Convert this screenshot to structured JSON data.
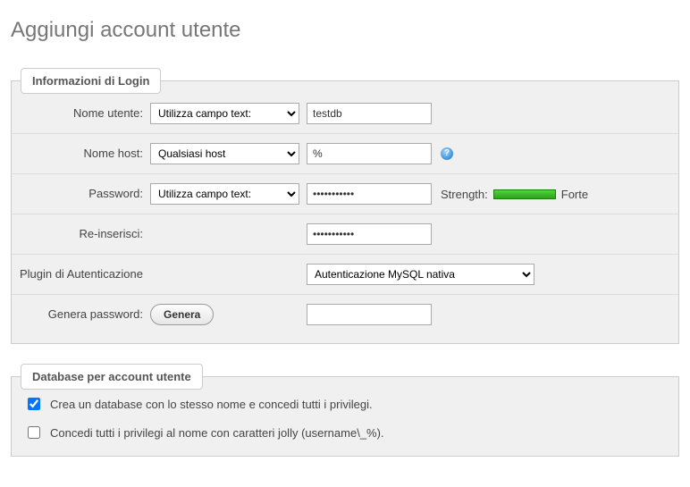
{
  "pageTitle": "Aggiungi account utente",
  "login": {
    "legend": "Informazioni di Login",
    "username": {
      "label": "Nome utente:",
      "selectValue": "Utilizza campo text:",
      "inputValue": "testdb"
    },
    "host": {
      "label": "Nome host:",
      "selectValue": "Qualsiasi host",
      "inputValue": "%"
    },
    "password": {
      "label": "Password:",
      "selectValue": "Utilizza campo text:",
      "inputValue": "•••••••••••",
      "strengthLabel": "Strength:",
      "strengthText": "Forte"
    },
    "retype": {
      "label": "Re-inserisci:",
      "inputValue": "•••••••••••"
    },
    "authPlugin": {
      "label": "Plugin di Autenticazione",
      "selectValue": "Autenticazione MySQL nativa"
    },
    "generate": {
      "label": "Genera password:",
      "button": "Genera",
      "inputValue": ""
    }
  },
  "database": {
    "legend": "Database per account utente",
    "opt1": {
      "checked": true,
      "label": "Crea un database con lo stesso nome e concedi tutti i privilegi."
    },
    "opt2": {
      "checked": false,
      "label": "Concedi tutti i privilegi al nome con caratteri jolly (username\\_%)."
    }
  }
}
